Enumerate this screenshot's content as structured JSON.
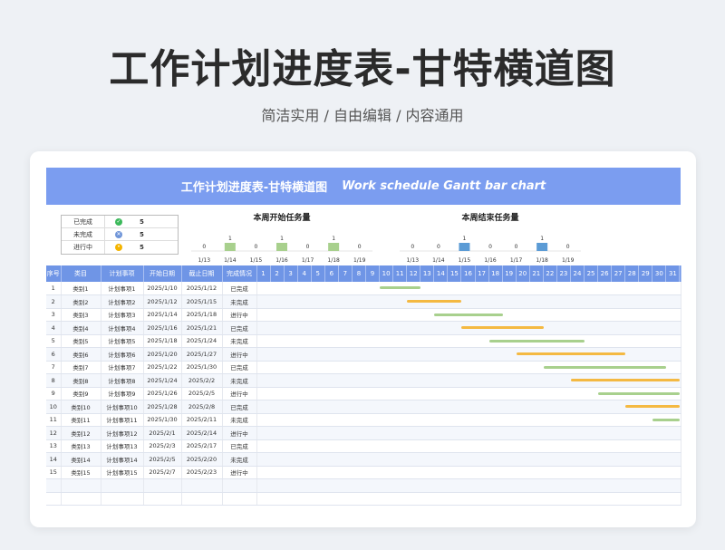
{
  "hero": {
    "title": "工作计划进度表-甘特横道图",
    "subtitle": "简洁实用 / 自由编辑 / 内容通用"
  },
  "banner": {
    "title_cn": "工作计划进度表-甘特横道图",
    "title_en": "Work schedule Gantt bar chart"
  },
  "legend": [
    {
      "label": "已完成",
      "icon": "check-circle-icon",
      "color": "#3cb95b",
      "count": "5"
    },
    {
      "label": "未完成",
      "icon": "x-circle-icon",
      "color": "#6f95d8",
      "count": "5"
    },
    {
      "label": "进行中",
      "icon": "clock-circle-icon",
      "color": "#f4b400",
      "count": "5"
    }
  ],
  "chart_data": [
    {
      "type": "bar",
      "title": "本周开始任务量",
      "categories": [
        "1/13",
        "1/14",
        "1/15",
        "1/16",
        "1/17",
        "1/18",
        "1/19"
      ],
      "values": [
        0,
        1,
        0,
        1,
        0,
        1,
        0
      ],
      "color": "#a8d08d"
    },
    {
      "type": "bar",
      "title": "本周结束任务量",
      "categories": [
        "1/13",
        "1/14",
        "1/15",
        "1/16",
        "1/17",
        "1/18",
        "1/19"
      ],
      "values": [
        0,
        0,
        1,
        0,
        0,
        1,
        0
      ],
      "color": "#5b9bd5"
    }
  ],
  "table": {
    "headers": [
      "序号",
      "类目",
      "计划事项",
      "开始日期",
      "截止日期",
      "完成情况"
    ],
    "days": [
      "1",
      "2",
      "3",
      "4",
      "5",
      "6",
      "7",
      "8",
      "9",
      "10",
      "11",
      "12",
      "13",
      "14",
      "15",
      "16",
      "17",
      "18",
      "19",
      "20",
      "21",
      "22",
      "23",
      "24",
      "25",
      "26",
      "27",
      "28",
      "29",
      "30",
      "31"
    ],
    "rows": [
      {
        "no": "1",
        "cat": "类别1",
        "item": "计划事项1",
        "start": "2025/1/10",
        "end": "2025/1/12",
        "status": "已完成",
        "bar_start": 10,
        "bar_end": 12,
        "bar_color": "#a8d08d"
      },
      {
        "no": "2",
        "cat": "类别2",
        "item": "计划事项2",
        "start": "2025/1/12",
        "end": "2025/1/15",
        "status": "未完成",
        "bar_start": 12,
        "bar_end": 15,
        "bar_color": "#f4b942"
      },
      {
        "no": "3",
        "cat": "类别3",
        "item": "计划事项3",
        "start": "2025/1/14",
        "end": "2025/1/18",
        "status": "进行中",
        "bar_start": 14,
        "bar_end": 18,
        "bar_color": "#a8d08d"
      },
      {
        "no": "4",
        "cat": "类别4",
        "item": "计划事项4",
        "start": "2025/1/16",
        "end": "2025/1/21",
        "status": "已完成",
        "bar_start": 16,
        "bar_end": 21,
        "bar_color": "#f4b942"
      },
      {
        "no": "5",
        "cat": "类别5",
        "item": "计划事项5",
        "start": "2025/1/18",
        "end": "2025/1/24",
        "status": "未完成",
        "bar_start": 18,
        "bar_end": 24,
        "bar_color": "#a8d08d"
      },
      {
        "no": "6",
        "cat": "类别6",
        "item": "计划事项6",
        "start": "2025/1/20",
        "end": "2025/1/27",
        "status": "进行中",
        "bar_start": 20,
        "bar_end": 27,
        "bar_color": "#f4b942"
      },
      {
        "no": "7",
        "cat": "类别7",
        "item": "计划事项7",
        "start": "2025/1/22",
        "end": "2025/1/30",
        "status": "已完成",
        "bar_start": 22,
        "bar_end": 30,
        "bar_color": "#a8d08d"
      },
      {
        "no": "8",
        "cat": "类别8",
        "item": "计划事项8",
        "start": "2025/1/24",
        "end": "2025/2/2",
        "status": "未完成",
        "bar_start": 24,
        "bar_end": 31,
        "bar_color": "#f4b942"
      },
      {
        "no": "9",
        "cat": "类别9",
        "item": "计划事项9",
        "start": "2025/1/26",
        "end": "2025/2/5",
        "status": "进行中",
        "bar_start": 26,
        "bar_end": 31,
        "bar_color": "#a8d08d"
      },
      {
        "no": "10",
        "cat": "类别10",
        "item": "计划事项10",
        "start": "2025/1/28",
        "end": "2025/2/8",
        "status": "已完成",
        "bar_start": 28,
        "bar_end": 31,
        "bar_color": "#f4b942"
      },
      {
        "no": "11",
        "cat": "类别11",
        "item": "计划事项11",
        "start": "2025/1/30",
        "end": "2025/2/11",
        "status": "未完成",
        "bar_start": 30,
        "bar_end": 31,
        "bar_color": "#a8d08d"
      },
      {
        "no": "12",
        "cat": "类别12",
        "item": "计划事项12",
        "start": "2025/2/1",
        "end": "2025/2/14",
        "status": "进行中"
      },
      {
        "no": "13",
        "cat": "类别13",
        "item": "计划事项13",
        "start": "2025/2/3",
        "end": "2025/2/17",
        "status": "已完成"
      },
      {
        "no": "14",
        "cat": "类别14",
        "item": "计划事项14",
        "start": "2025/2/5",
        "end": "2025/2/20",
        "status": "未完成"
      },
      {
        "no": "15",
        "cat": "类别15",
        "item": "计划事项15",
        "start": "2025/2/7",
        "end": "2025/2/23",
        "status": "进行中"
      }
    ]
  }
}
